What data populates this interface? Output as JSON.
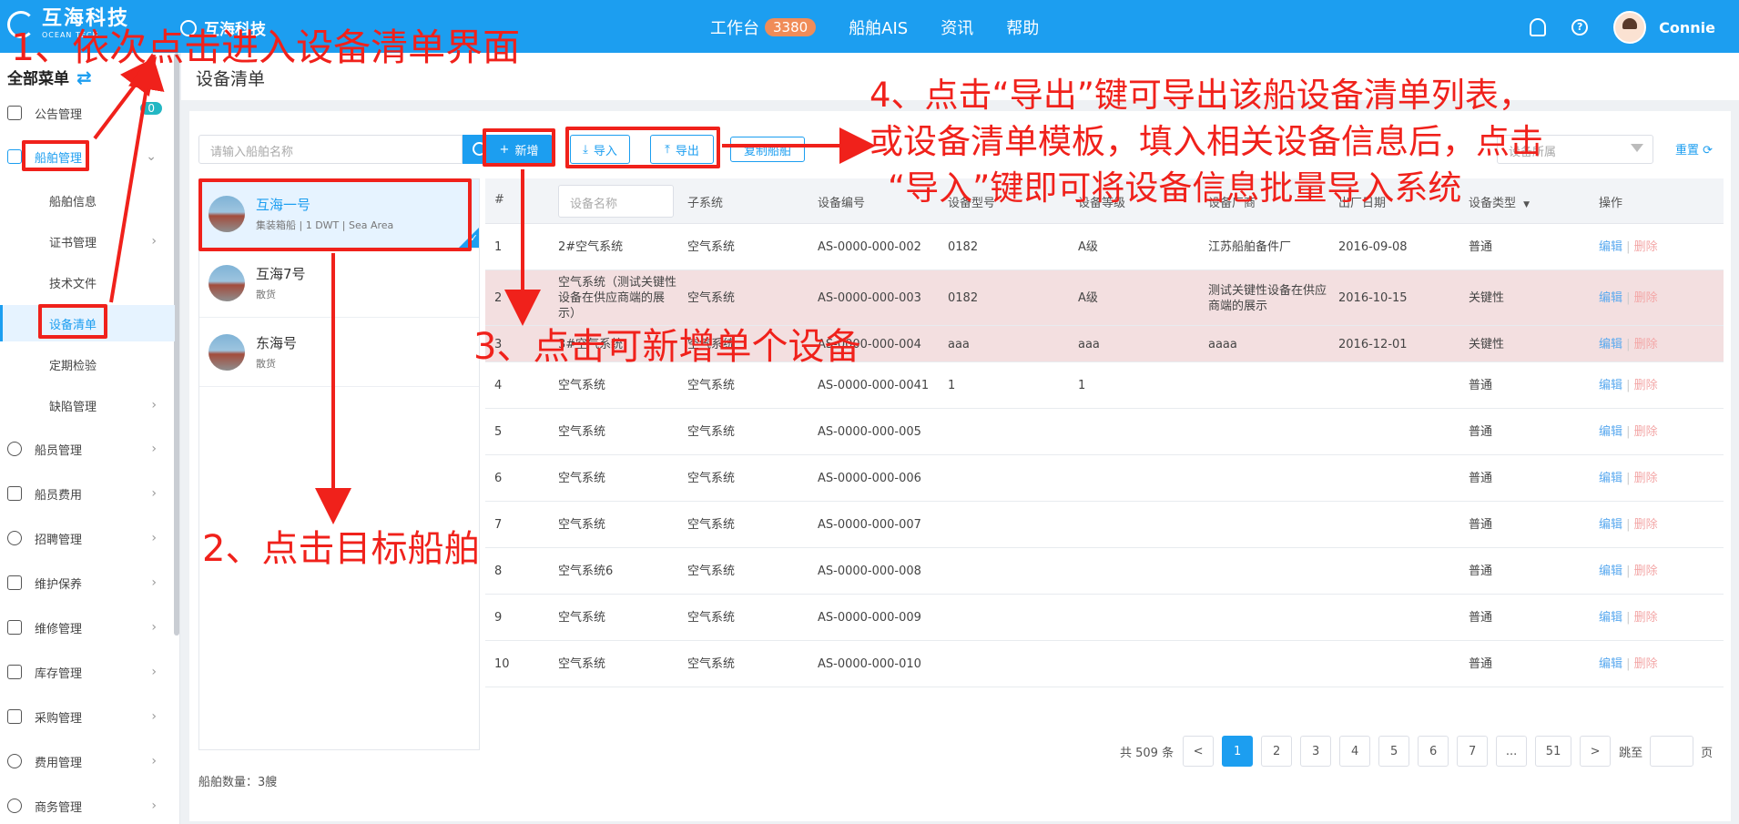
{
  "topbar": {
    "logo_name": "互海科技",
    "logo_sub": "OCEAN TECH",
    "company": "互海科技",
    "nav": [
      {
        "label": "工作台",
        "badge": "3380"
      },
      {
        "label": "船舶AIS"
      },
      {
        "label": "资讯"
      },
      {
        "label": "帮助"
      }
    ],
    "username": "Connie"
  },
  "sidebar": {
    "header": "全部菜单",
    "items": [
      {
        "label": "公告管理",
        "badge": "0"
      },
      {
        "label": "船舶管理"
      },
      {
        "label": "船舶信息"
      },
      {
        "label": "证书管理"
      },
      {
        "label": "技术文件"
      },
      {
        "label": "设备清单"
      },
      {
        "label": "定期检验"
      },
      {
        "label": "缺陷管理"
      },
      {
        "label": "船员管理"
      },
      {
        "label": "船员费用"
      },
      {
        "label": "招聘管理"
      },
      {
        "label": "维护保养"
      },
      {
        "label": "维修管理"
      },
      {
        "label": "库存管理"
      },
      {
        "label": "采购管理"
      },
      {
        "label": "费用管理"
      },
      {
        "label": "商务管理"
      }
    ]
  },
  "page": {
    "title": "设备清单"
  },
  "ships": {
    "search_placeholder": "请输入船舶名称",
    "list": [
      {
        "name": "互海一号",
        "meta": "集装箱船 | 1 DWT | Sea Area"
      },
      {
        "name": "互海7号",
        "meta": "散货"
      },
      {
        "name": "东海号",
        "meta": "散货"
      }
    ],
    "count": "船舶数量：3艘"
  },
  "toolbar": {
    "add": "新增",
    "import": "导入",
    "export": "导出",
    "copy": "复制船舶",
    "filter_placeholder": "设备所属",
    "reset": "重置"
  },
  "table": {
    "headers": [
      "#",
      "设备名称",
      "子系统",
      "设备编号",
      "设备型号",
      "设备等级",
      "设备厂商",
      "出厂日期",
      "设备类型",
      "操作"
    ],
    "name_filter_placeholder": "设备名称",
    "edit": "编辑",
    "delete": "删除",
    "rows": [
      {
        "no": "1",
        "name": "2#空气系统",
        "sub": "空气系统",
        "code": "AS-0000-000-002",
        "model": "0182",
        "grade": "A级",
        "maker": "江苏船舶备件厂",
        "date": "2016-09-08",
        "type": "普通"
      },
      {
        "no": "2",
        "name": "空气系统（测试关键性设备在供应商端的展示）",
        "sub": "空气系统",
        "code": "AS-0000-000-003",
        "model": "0182",
        "grade": "A级",
        "maker": "测试关键性设备在供应商端的展示",
        "date": "2016-10-15",
        "type": "关键性"
      },
      {
        "no": "3",
        "name": "3#空气系统",
        "sub": "空气系统",
        "code": "AS-0000-000-004",
        "model": "aaa",
        "grade": "aaa",
        "maker": "aaaa",
        "date": "2016-12-01",
        "type": "关键性"
      },
      {
        "no": "4",
        "name": "空气系统",
        "sub": "空气系统",
        "code": "AS-0000-000-0041",
        "model": "1",
        "grade": "1",
        "maker": "",
        "date": "",
        "type": "普通"
      },
      {
        "no": "5",
        "name": "空气系统",
        "sub": "空气系统",
        "code": "AS-0000-000-005",
        "model": "",
        "grade": "",
        "maker": "",
        "date": "",
        "type": "普通"
      },
      {
        "no": "6",
        "name": "空气系统",
        "sub": "空气系统",
        "code": "AS-0000-000-006",
        "model": "",
        "grade": "",
        "maker": "",
        "date": "",
        "type": "普通"
      },
      {
        "no": "7",
        "name": "空气系统",
        "sub": "空气系统",
        "code": "AS-0000-000-007",
        "model": "",
        "grade": "",
        "maker": "",
        "date": "",
        "type": "普通"
      },
      {
        "no": "8",
        "name": "空气系统6",
        "sub": "空气系统",
        "code": "AS-0000-000-008",
        "model": "",
        "grade": "",
        "maker": "",
        "date": "",
        "type": "普通"
      },
      {
        "no": "9",
        "name": "空气系统",
        "sub": "空气系统",
        "code": "AS-0000-000-009",
        "model": "",
        "grade": "",
        "maker": "",
        "date": "",
        "type": "普通"
      },
      {
        "no": "10",
        "name": "空气系统",
        "sub": "空气系统",
        "code": "AS-0000-000-010",
        "model": "",
        "grade": "",
        "maker": "",
        "date": "",
        "type": "普通"
      }
    ]
  },
  "pagination": {
    "total": "共 509 条",
    "prev": "<",
    "pages": [
      "1",
      "2",
      "3",
      "4",
      "5",
      "6",
      "7",
      "...",
      "51"
    ],
    "next": ">",
    "jump_label": "跳至",
    "page_suffix": "页"
  },
  "annotations": {
    "step1": "1、依次点击进入设备清单界面",
    "step2": "2、点击目标船舶",
    "step3": "3、点击可新增单个设备",
    "step4_line1": "4、点击“导出”键可导出该船设备清单列表，",
    "step4_line2": "或设备清单模板，填入相关设备信息后，点击",
    "step4_line3": "“导入”键即可将设备信息批量导入系统",
    "color": "#f0211b"
  }
}
